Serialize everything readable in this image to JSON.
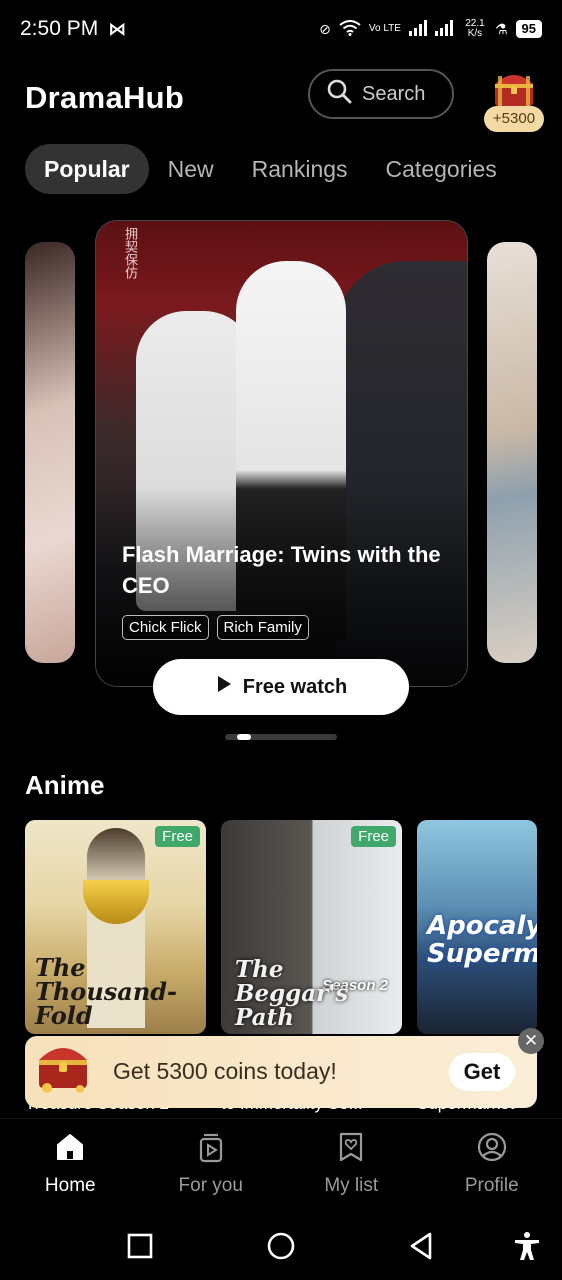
{
  "status_bar": {
    "time": "2:50 PM",
    "network_label": "Vo LTE",
    "speed": "22.1 K/s",
    "battery": "95"
  },
  "header": {
    "app_title": "DramaHub",
    "search_label": "Search",
    "coins_badge": "+5300"
  },
  "tabs": [
    {
      "label": "Popular",
      "active": true
    },
    {
      "label": "New"
    },
    {
      "label": "Rankings"
    },
    {
      "label": "Categories"
    }
  ],
  "featured": {
    "title": "Flash Marriage: Twins with the CEO",
    "tags": [
      "Chick Flick",
      "Rich Family"
    ],
    "watch_label": "Free watch",
    "poster_text": "拥契保仿"
  },
  "anime": {
    "section_title": "Anime",
    "items": [
      {
        "badge": "Free",
        "cover_text": "The Thousand-Fold",
        "name": "Treasure Season 2"
      },
      {
        "badge": "Free",
        "cover_text": "The Beggar's Path",
        "cover_season": "Season 2",
        "name": "to Immortality Se..."
      },
      {
        "cover_text": "Apocaly Superma",
        "name": "Supermarket"
      }
    ]
  },
  "promo": {
    "text": "Get 5300 coins today!",
    "button": "Get",
    "close": "✕"
  },
  "bottom_nav": [
    {
      "label": "Home",
      "icon": "home-icon",
      "active": true
    },
    {
      "label": "For you",
      "icon": "play-video-icon"
    },
    {
      "label": "My list",
      "icon": "bookmark-heart-icon"
    },
    {
      "label": "Profile",
      "icon": "user-circle-icon"
    }
  ],
  "colors": {
    "background": "#000000",
    "tab_active_bg": "#333333",
    "free_badge": "#3fa86a",
    "coin_pill": "#f3d9a4",
    "promo_bg": "#f7e1bb"
  }
}
